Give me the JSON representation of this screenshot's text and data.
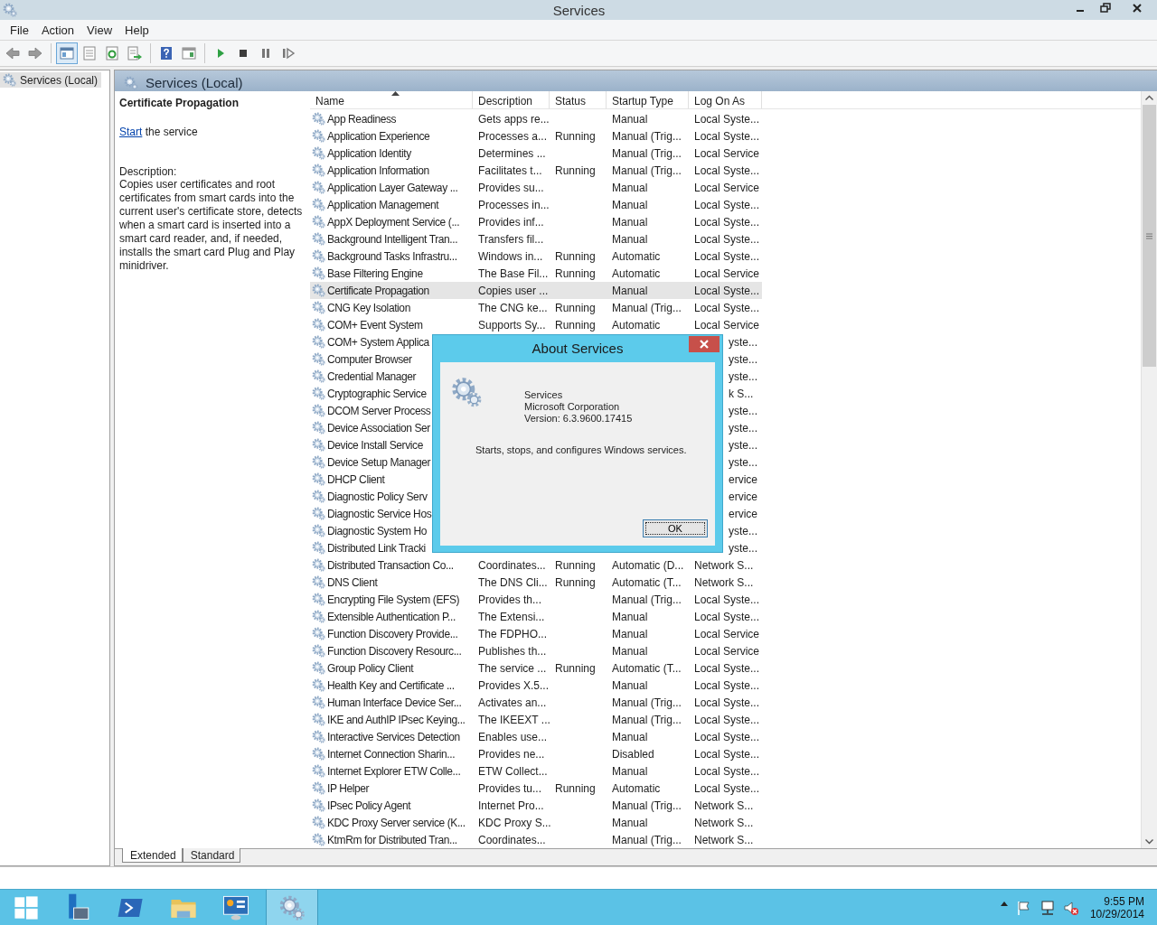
{
  "window": {
    "title": "Services"
  },
  "menu": [
    {
      "label": "File"
    },
    {
      "label": "Action"
    },
    {
      "label": "View"
    },
    {
      "label": "Help"
    }
  ],
  "toolbar": [
    {
      "kind": "back",
      "selected": false
    },
    {
      "kind": "forward",
      "selected": false
    },
    {
      "kind": "sep"
    },
    {
      "kind": "tree",
      "selected": true
    },
    {
      "kind": "props",
      "selected": false
    },
    {
      "kind": "refresh",
      "selected": false
    },
    {
      "kind": "export",
      "selected": false
    },
    {
      "kind": "sep"
    },
    {
      "kind": "help",
      "selected": false
    },
    {
      "kind": "pane",
      "selected": false
    },
    {
      "kind": "sep"
    },
    {
      "kind": "play",
      "selected": false
    },
    {
      "kind": "stop",
      "selected": false
    },
    {
      "kind": "pause",
      "selected": false
    },
    {
      "kind": "resume",
      "selected": false
    }
  ],
  "tree": {
    "items": [
      {
        "label": "Services (Local)",
        "selected": true
      }
    ]
  },
  "content_header": {
    "title": "Services (Local)"
  },
  "detail": {
    "title": "Certificate Propagation",
    "action_link": "Start",
    "action_text": " the service",
    "description_label": "Description:",
    "description": "Copies user certificates and root certificates from smart cards into the current user's certificate store, detects when a smart card is inserted into a smart card reader, and, if needed, installs the smart card Plug and Play minidriver."
  },
  "table": {
    "columns": [
      {
        "label": "Name",
        "sorted": true
      },
      {
        "label": "Description",
        "sorted": false
      },
      {
        "label": "Status",
        "sorted": false
      },
      {
        "label": "Startup Type",
        "sorted": false
      },
      {
        "label": "Log On As",
        "sorted": false
      }
    ],
    "rows": [
      {
        "name": "App Readiness",
        "description": "Gets apps re...",
        "status": "",
        "startup": "Manual",
        "logon": "Local Syste...",
        "selected": false
      },
      {
        "name": "Application Experience",
        "description": "Processes a...",
        "status": "Running",
        "startup": "Manual (Trig...",
        "logon": "Local Syste...",
        "selected": false
      },
      {
        "name": "Application Identity",
        "description": "Determines ...",
        "status": "",
        "startup": "Manual (Trig...",
        "logon": "Local Service",
        "selected": false
      },
      {
        "name": "Application Information",
        "description": "Facilitates t...",
        "status": "Running",
        "startup": "Manual (Trig...",
        "logon": "Local Syste...",
        "selected": false
      },
      {
        "name": "Application Layer Gateway ...",
        "description": "Provides su...",
        "status": "",
        "startup": "Manual",
        "logon": "Local Service",
        "selected": false
      },
      {
        "name": "Application Management",
        "description": "Processes in...",
        "status": "",
        "startup": "Manual",
        "logon": "Local Syste...",
        "selected": false
      },
      {
        "name": "AppX Deployment Service (...",
        "description": "Provides inf...",
        "status": "",
        "startup": "Manual",
        "logon": "Local Syste...",
        "selected": false
      },
      {
        "name": "Background Intelligent Tran...",
        "description": "Transfers fil...",
        "status": "",
        "startup": "Manual",
        "logon": "Local Syste...",
        "selected": false
      },
      {
        "name": "Background Tasks Infrastru...",
        "description": "Windows in...",
        "status": "Running",
        "startup": "Automatic",
        "logon": "Local Syste...",
        "selected": false
      },
      {
        "name": "Base Filtering Engine",
        "description": "The Base Fil...",
        "status": "Running",
        "startup": "Automatic",
        "logon": "Local Service",
        "selected": false
      },
      {
        "name": "Certificate Propagation",
        "description": "Copies user ...",
        "status": "",
        "startup": "Manual",
        "logon": "Local Syste...",
        "selected": true
      },
      {
        "name": "CNG Key Isolation",
        "description": "The CNG ke...",
        "status": "Running",
        "startup": "Manual (Trig...",
        "logon": "Local Syste...",
        "selected": false
      },
      {
        "name": "COM+ Event System",
        "description": "Supports Sy...",
        "status": "Running",
        "startup": "Automatic",
        "logon": "Local Service",
        "selected": false
      },
      {
        "name": "COM+ System Applica",
        "logon": "yste...",
        "selected": false
      },
      {
        "name": "Computer Browser",
        "logon": "yste...",
        "selected": false
      },
      {
        "name": "Credential Manager",
        "logon": "yste...",
        "selected": false
      },
      {
        "name": "Cryptographic Service",
        "logon": "k S...",
        "selected": false
      },
      {
        "name": "DCOM Server Process",
        "logon": "yste...",
        "selected": false
      },
      {
        "name": "Device Association Ser",
        "logon": "yste...",
        "selected": false
      },
      {
        "name": "Device Install Service",
        "logon": "yste...",
        "selected": false
      },
      {
        "name": "Device Setup Manager",
        "logon": "yste...",
        "selected": false
      },
      {
        "name": "DHCP Client",
        "logon": "ervice",
        "selected": false
      },
      {
        "name": "Diagnostic Policy Serv",
        "logon": "ervice",
        "selected": false
      },
      {
        "name": "Diagnostic Service Hos",
        "logon": "ervice",
        "selected": false
      },
      {
        "name": "Diagnostic System Ho",
        "logon": "yste...",
        "selected": false
      },
      {
        "name": "Distributed Link Tracki",
        "logon": "yste...",
        "selected": false
      },
      {
        "name": "Distributed Transaction Co...",
        "description": "Coordinates...",
        "status": "Running",
        "startup": "Automatic (D...",
        "logon": "Network S...",
        "selected": false
      },
      {
        "name": "DNS Client",
        "description": "The DNS Cli...",
        "status": "Running",
        "startup": "Automatic (T...",
        "logon": "Network S...",
        "selected": false
      },
      {
        "name": "Encrypting File System (EFS)",
        "description": "Provides th...",
        "status": "",
        "startup": "Manual (Trig...",
        "logon": "Local Syste...",
        "selected": false
      },
      {
        "name": "Extensible Authentication P...",
        "description": "The Extensi...",
        "status": "",
        "startup": "Manual",
        "logon": "Local Syste...",
        "selected": false
      },
      {
        "name": "Function Discovery Provide...",
        "description": "The FDPHO...",
        "status": "",
        "startup": "Manual",
        "logon": "Local Service",
        "selected": false
      },
      {
        "name": "Function Discovery Resourc...",
        "description": "Publishes th...",
        "status": "",
        "startup": "Manual",
        "logon": "Local Service",
        "selected": false
      },
      {
        "name": "Group Policy Client",
        "description": "The service ...",
        "status": "Running",
        "startup": "Automatic (T...",
        "logon": "Local Syste...",
        "selected": false
      },
      {
        "name": "Health Key and Certificate ...",
        "description": "Provides X.5...",
        "status": "",
        "startup": "Manual",
        "logon": "Local Syste...",
        "selected": false
      },
      {
        "name": "Human Interface Device Ser...",
        "description": "Activates an...",
        "status": "",
        "startup": "Manual (Trig...",
        "logon": "Local Syste...",
        "selected": false
      },
      {
        "name": "IKE and AuthIP IPsec Keying...",
        "description": "The IKEEXT ...",
        "status": "",
        "startup": "Manual (Trig...",
        "logon": "Local Syste...",
        "selected": false
      },
      {
        "name": "Interactive Services Detection",
        "description": "Enables use...",
        "status": "",
        "startup": "Manual",
        "logon": "Local Syste...",
        "selected": false
      },
      {
        "name": "Internet Connection Sharin...",
        "description": "Provides ne...",
        "status": "",
        "startup": "Disabled",
        "logon": "Local Syste...",
        "selected": false
      },
      {
        "name": "Internet Explorer ETW Colle...",
        "description": "ETW Collect...",
        "status": "",
        "startup": "Manual",
        "logon": "Local Syste...",
        "selected": false
      },
      {
        "name": "IP Helper",
        "description": "Provides tu...",
        "status": "Running",
        "startup": "Automatic",
        "logon": "Local Syste...",
        "selected": false
      },
      {
        "name": "IPsec Policy Agent",
        "description": "Internet Pro...",
        "status": "",
        "startup": "Manual (Trig...",
        "logon": "Network S...",
        "selected": false
      },
      {
        "name": "KDC Proxy Server service (K...",
        "description": "KDC Proxy S...",
        "status": "",
        "startup": "Manual",
        "logon": "Network S...",
        "selected": false
      },
      {
        "name": "KtmRm for Distributed Tran...",
        "description": "Coordinates...",
        "status": "",
        "startup": "Manual (Trig...",
        "logon": "Network S...",
        "selected": false
      }
    ]
  },
  "view_tabs": [
    {
      "label": "Extended",
      "selected": true
    },
    {
      "label": "Standard",
      "selected": false
    }
  ],
  "dialog": {
    "title": "About Services",
    "product": "Services",
    "company": "Microsoft Corporation",
    "version": "Version: 6.3.9600.17415",
    "summary": "Starts, stops, and configures Windows services.",
    "button": "OK"
  },
  "taskbar": {
    "items": [
      {
        "kind": "start",
        "selected": false
      },
      {
        "kind": "server",
        "selected": false
      },
      {
        "kind": "shell",
        "selected": false
      },
      {
        "kind": "folder",
        "selected": false
      },
      {
        "kind": "panel",
        "selected": false
      },
      {
        "kind": "services",
        "selected": true
      }
    ],
    "tray": [
      {
        "kind": "arrow"
      },
      {
        "kind": "flag"
      },
      {
        "kind": "network"
      },
      {
        "kind": "speaker"
      }
    ],
    "time": "9:55 PM",
    "date": "10/29/2014"
  }
}
